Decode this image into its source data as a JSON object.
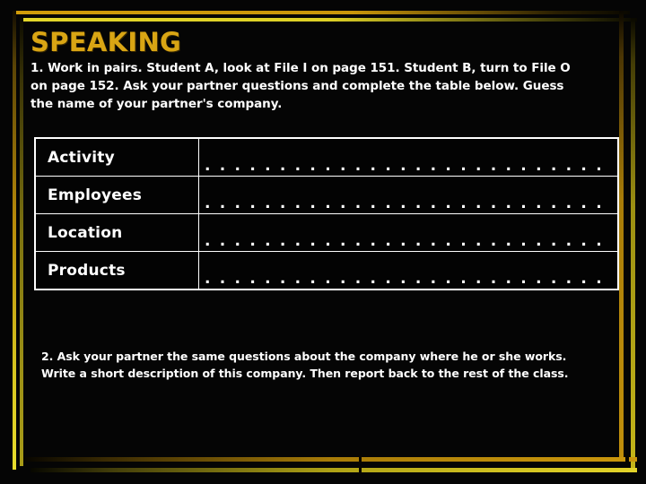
{
  "slide": {
    "title": "SPEAKING",
    "intro_text": "1. Work in pairs. Student A, look at File I on page 151. Student B, turn to File O on page 152. Ask your partner questions and complete the table below. Guess the name of your partner's company.",
    "outro_text": "2. Ask your partner the same questions about the company where he or she works. Write a short description of this company. Then report back to the rest of the class.",
    "table": {
      "rows": [
        {
          "label": "Activity",
          "value": ". . . . . . . . . . . . . . . . . . . . . . . . . . . . . . . . . ."
        },
        {
          "label": "Employees",
          "value": ". . . . . . . . . . . . . . . . . . . . . . . . . . . . . . . . . ."
        },
        {
          "label": "Location",
          "value": ". . . . . . . . . . . . . . . . . . . . . . . . . . . . . . . . . ."
        },
        {
          "label": "Products",
          "value": ". . . . . . . . . . . . . . . . . . . . . . . . . . . . . . . . . ."
        }
      ]
    },
    "colors": {
      "background": "#050505",
      "title": "#d9a514",
      "text": "#ffffff",
      "frame_gold": "#c08f0b",
      "frame_yellow": "#e3d42a"
    }
  }
}
